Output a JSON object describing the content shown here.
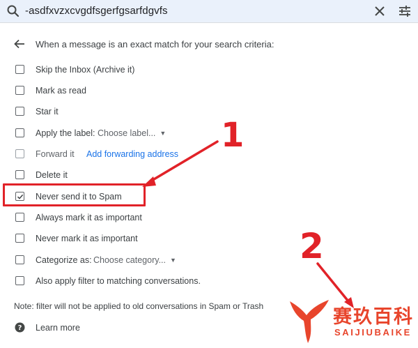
{
  "search": {
    "query": "-asdfxvzxcvgdfsgerfgsarfdgvfs"
  },
  "header": {
    "text": "When a message is an exact match for your search criteria:"
  },
  "options": [
    {
      "label": "Skip the Inbox (Archive it)",
      "checked": false
    },
    {
      "label": "Mark as read",
      "checked": false
    },
    {
      "label": "Star it",
      "checked": false
    },
    {
      "label": "Apply the label:",
      "checked": false,
      "dropdown": "Choose label..."
    },
    {
      "label": "Forward it",
      "checked": false,
      "link": "Add forwarding address"
    },
    {
      "label": "Delete it",
      "checked": false
    },
    {
      "label": "Never send it to Spam",
      "checked": true
    },
    {
      "label": "Always mark it as important",
      "checked": false
    },
    {
      "label": "Never mark it as important",
      "checked": false
    },
    {
      "label": "Categorize as:",
      "checked": false,
      "dropdown": "Choose category..."
    },
    {
      "label": "Also apply filter to matching conversations.",
      "checked": false
    }
  ],
  "note": "Note: filter will not be applied to old conversations in Spam or Trash",
  "learn_more": "Learn more",
  "annotations": {
    "number_1": "1",
    "number_2": "2",
    "color": "#e12228"
  },
  "watermark": {
    "chinese": "赛玖百科",
    "english": "SAIJIUBAIKE"
  },
  "colors": {
    "search_bg": "#eaf1fb",
    "link": "#1a73e8",
    "accent": "#e12228"
  }
}
